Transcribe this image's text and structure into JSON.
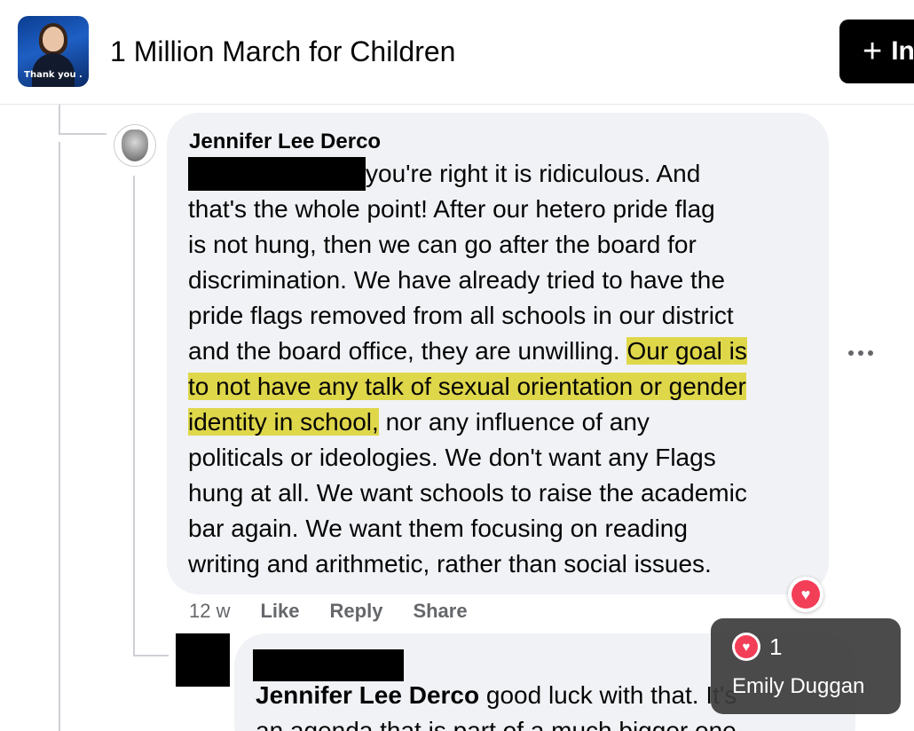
{
  "header": {
    "group_name": "1 Million March for Children",
    "avatar_caption": "Thank you .",
    "invite_label": "In",
    "invite_icon": "plus-icon"
  },
  "comment": {
    "author": "Jennifer Lee Derco",
    "lines": [
      "you're right it is ridiculous. And",
      "that's the whole point! After our hetero pride flag",
      "is not hung, then we can go after the board for",
      "discrimination. We have already tried to have the",
      "pride flags removed from all schools in our district"
    ],
    "line6_plain": "and the board office, they are unwilling. ",
    "line6_highlight": "Our goal is",
    "line7_highlight": "to not have any talk of sexual orientation or gender",
    "line8_highlight": "identity in school,",
    "line8_plain": " nor any influence of any",
    "lines_after": [
      "politicals or ideologies. We don't want any Flags",
      "hung at all. We want schools to raise the academic",
      "bar again. We want them focusing on reading",
      "writing and arithmetic, rather than social issues."
    ],
    "timestamp": "12 w",
    "actions": {
      "like": "Like",
      "reply": "Reply",
      "share": "Share"
    },
    "highlight_color": "#dfd74a"
  },
  "reply": {
    "mention": "Jennifer Lee Derco",
    "text": " good luck with that. It's",
    "text_line2": "an agenda that is part of a much bigger one"
  },
  "reaction_tooltip": {
    "icon": "love-reaction-icon",
    "count": "1",
    "reactor": "Emily Duggan"
  }
}
